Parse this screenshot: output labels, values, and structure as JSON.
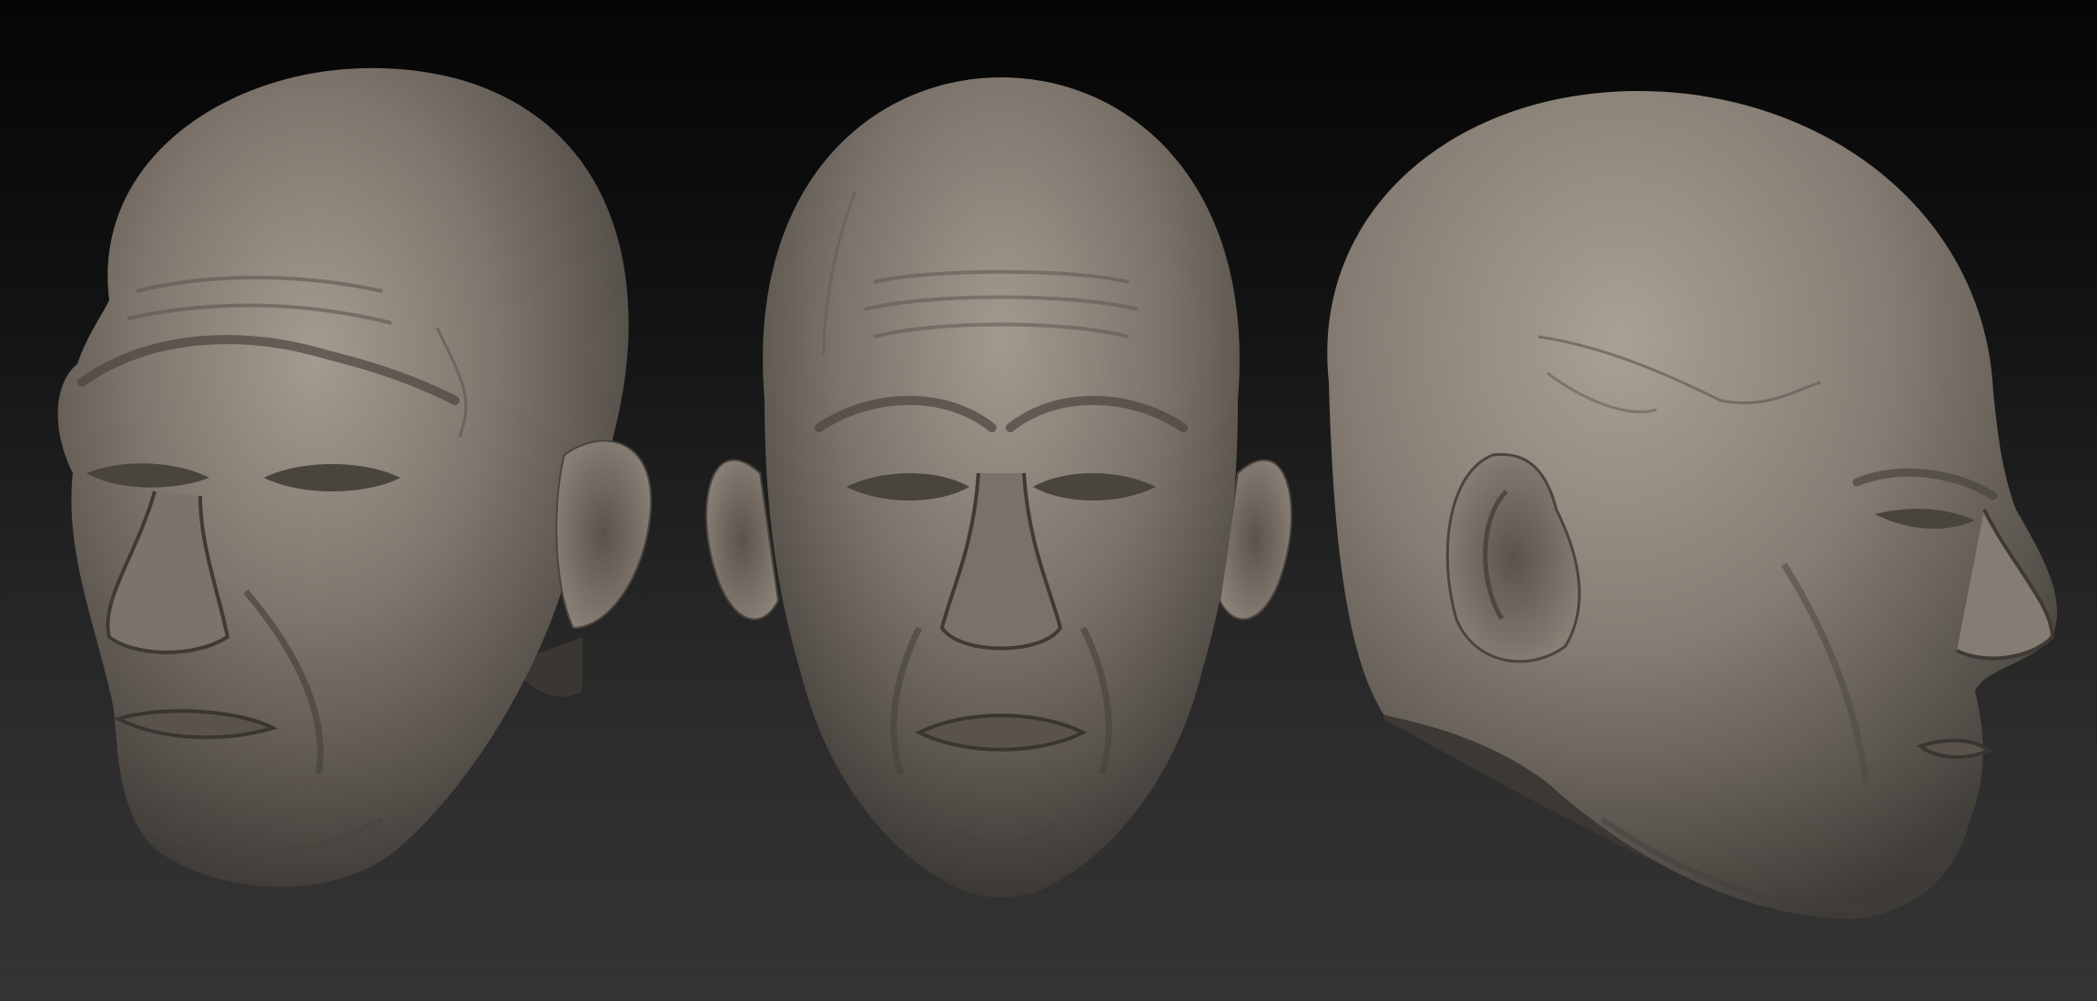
{
  "scene": {
    "background": {
      "top_color": "#050505",
      "bottom_color": "#3a3a3a"
    },
    "clay_color": "#8a8178",
    "views": [
      {
        "id": "three-quarter-left",
        "label": ""
      },
      {
        "id": "front",
        "label": ""
      },
      {
        "id": "profile-right",
        "label": ""
      }
    ]
  }
}
